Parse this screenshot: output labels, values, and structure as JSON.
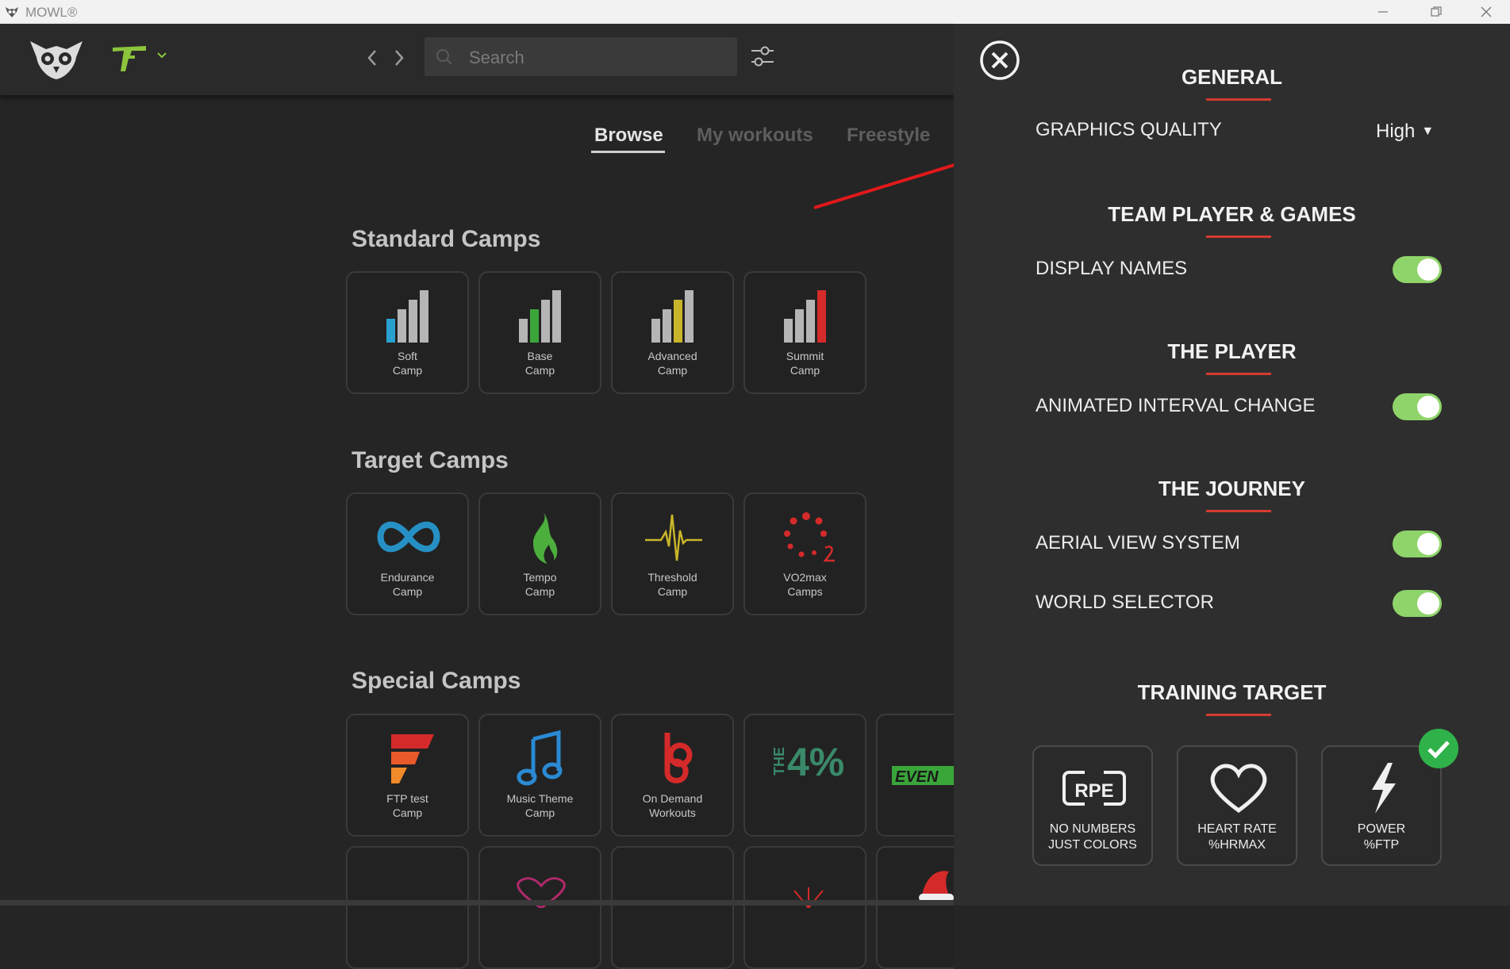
{
  "window": {
    "title": "MOWL®",
    "minimize_icon": "minimize-icon",
    "restore_icon": "restore-icon",
    "close_icon": "window-close-icon"
  },
  "toolbar": {
    "logo_icon": "owl-logo-icon",
    "device_icon": "bike-trainer-icon",
    "search_placeholder": "Search"
  },
  "tabs": [
    {
      "label": "Browse",
      "active": true
    },
    {
      "label": "My workouts",
      "active": false
    },
    {
      "label": "Freestyle",
      "active": false
    }
  ],
  "sections": {
    "standard": {
      "title": "Standard Camps",
      "cards": [
        {
          "label": "Soft\nCamp",
          "icon": "bars-blue-icon"
        },
        {
          "label": "Base\nCamp",
          "icon": "bars-green-icon"
        },
        {
          "label": "Advanced\nCamp",
          "icon": "bars-yellow-icon"
        },
        {
          "label": "Summit\nCamp",
          "icon": "bars-red-icon"
        }
      ]
    },
    "target": {
      "title": "Target Camps",
      "cards": [
        {
          "label": "Endurance\nCamp",
          "icon": "infinity-icon"
        },
        {
          "label": "Tempo\nCamp",
          "icon": "flame-icon"
        },
        {
          "label": "Threshold\nCamp",
          "icon": "heartbeat-icon"
        },
        {
          "label": "VO2max\nCamps",
          "icon": "dots-circle-icon"
        }
      ]
    },
    "special": {
      "title": "Special Camps",
      "cards": [
        {
          "label": "FTP test\nCamp",
          "icon": "ftp-flag-icon"
        },
        {
          "label": "Music Theme\nCamp",
          "icon": "music-note-icon"
        },
        {
          "label": "On Demand\nWorkouts",
          "icon": "on-demand-icon"
        },
        {
          "label": "",
          "icon": "the-4-percent-icon",
          "logo_text": "THE 4%"
        },
        {
          "label": "",
          "icon": "even-logo-icon",
          "logo_text": "EVEN"
        }
      ]
    }
  },
  "settings": {
    "general": {
      "heading": "GENERAL",
      "graphics_quality_label": "GRAPHICS QUALITY",
      "graphics_quality_value": "High"
    },
    "team": {
      "heading": "TEAM PLAYER & GAMES",
      "display_names_label": "DISPLAY NAMES",
      "display_names_on": true
    },
    "player": {
      "heading": "THE PLAYER",
      "animated_interval_label": "ANIMATED INTERVAL CHANGE",
      "animated_interval_on": true
    },
    "journey": {
      "heading": "THE JOURNEY",
      "aerial_view_label": "AERIAL VIEW SYSTEM",
      "aerial_view_on": true,
      "world_selector_label": "WORLD SELECTOR",
      "world_selector_on": true
    },
    "training_target": {
      "heading": "TRAINING TARGET",
      "options": [
        {
          "label": "NO NUMBERS\nJUST COLORS",
          "icon": "rpe-icon",
          "icon_text": "RPE",
          "selected": false
        },
        {
          "label": "HEART RATE\n%HRMAX",
          "icon": "heart-icon",
          "selected": false
        },
        {
          "label": "POWER\n%FTP",
          "icon": "lightning-bolt-icon",
          "selected": true
        }
      ]
    }
  },
  "colors": {
    "accent_red": "#d63a2f",
    "toggle_green": "#8fd46a",
    "check_green": "#2fb24a",
    "annotation_arrow": "#e0191b"
  }
}
